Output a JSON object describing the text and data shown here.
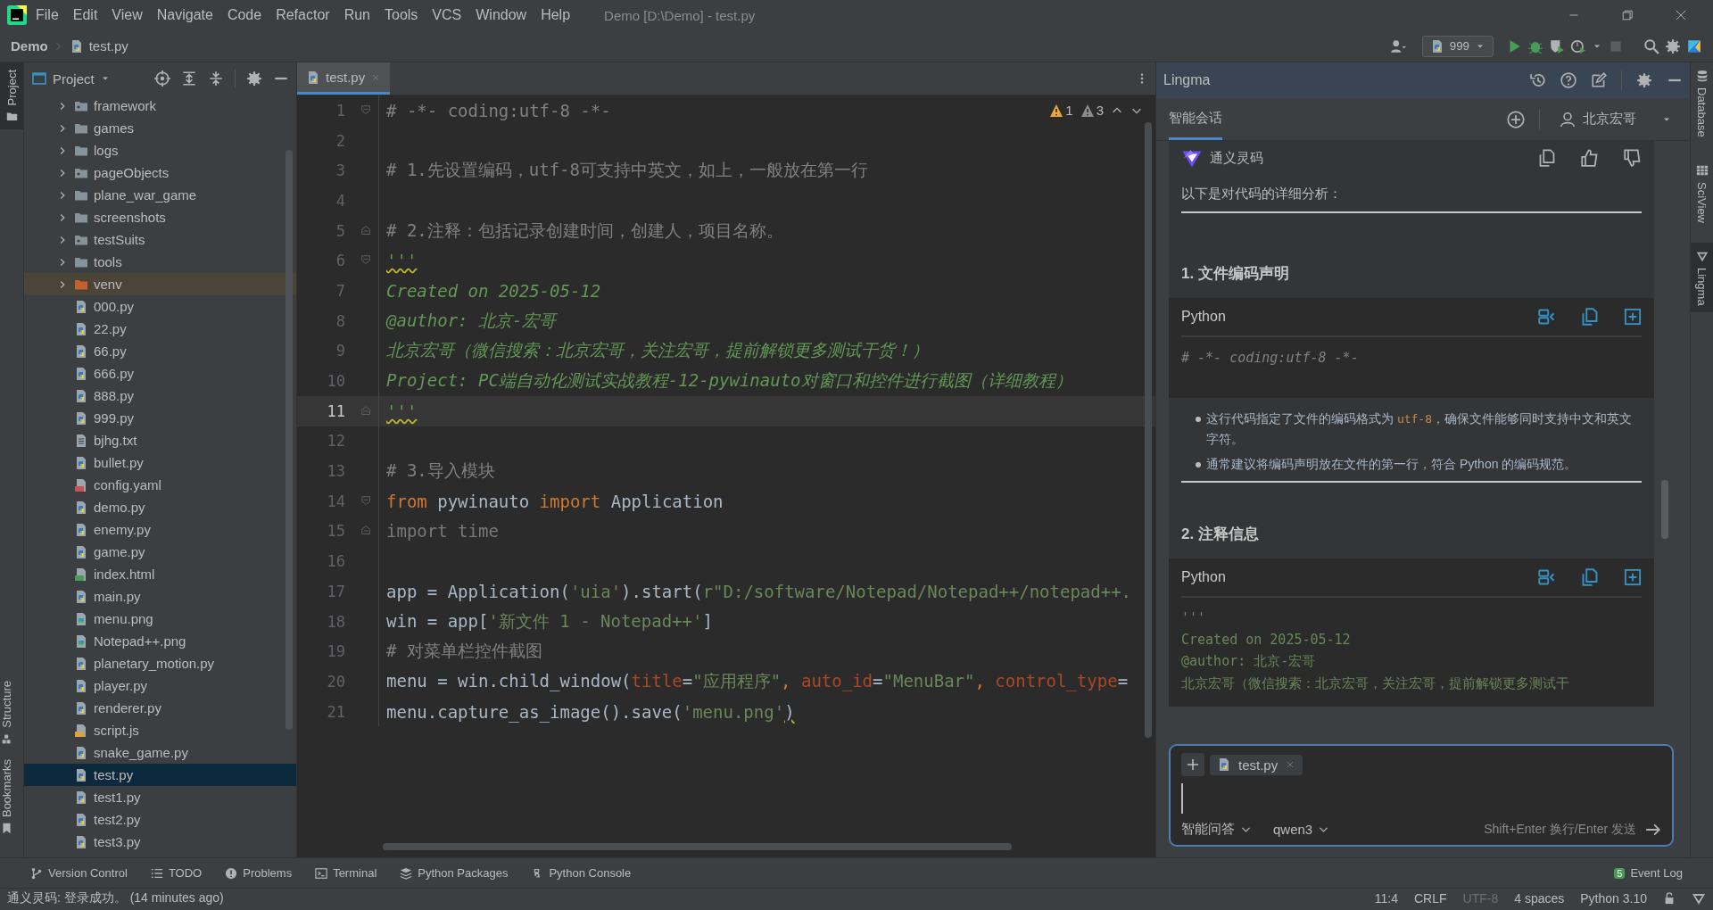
{
  "window": {
    "title": "Demo [D:\\Demo] - test.py"
  },
  "menu": [
    "File",
    "Edit",
    "View",
    "Navigate",
    "Code",
    "Refactor",
    "Run",
    "Tools",
    "VCS",
    "Window",
    "Help"
  ],
  "breadcrumbs": [
    "Demo",
    "test.py"
  ],
  "run_config": "999",
  "left_strip": [
    {
      "label": "Project",
      "selected": true,
      "kind": "top"
    },
    {
      "label": "Structure",
      "selected": false,
      "kind": "bottom"
    },
    {
      "label": "Bookmarks",
      "selected": false,
      "kind": "bottom"
    }
  ],
  "project": {
    "title": "Project",
    "items": [
      {
        "name": "framework",
        "kind": "package",
        "selected": false
      },
      {
        "name": "games",
        "kind": "folder",
        "selected": false
      },
      {
        "name": "logs",
        "kind": "folder",
        "selected": false
      },
      {
        "name": "pageObjects",
        "kind": "package",
        "selected": false
      },
      {
        "name": "plane_war_game",
        "kind": "folder",
        "selected": false
      },
      {
        "name": "screenshots",
        "kind": "folder",
        "selected": false
      },
      {
        "name": "testSuits",
        "kind": "package",
        "selected": false
      },
      {
        "name": "tools",
        "kind": "folder",
        "selected": false
      },
      {
        "name": "venv",
        "kind": "venv",
        "selected": false
      },
      {
        "name": "000.py",
        "kind": "python",
        "selected": false
      },
      {
        "name": "22.py",
        "kind": "python",
        "selected": false
      },
      {
        "name": "66.py",
        "kind": "python",
        "selected": false
      },
      {
        "name": "666.py",
        "kind": "python",
        "selected": false
      },
      {
        "name": "888.py",
        "kind": "python",
        "selected": false
      },
      {
        "name": "999.py",
        "kind": "python",
        "selected": false
      },
      {
        "name": "bjhg.txt",
        "kind": "text",
        "selected": false
      },
      {
        "name": "bullet.py",
        "kind": "python",
        "selected": false
      },
      {
        "name": "config.yaml",
        "kind": "yaml",
        "selected": false
      },
      {
        "name": "demo.py",
        "kind": "python",
        "selected": false
      },
      {
        "name": "enemy.py",
        "kind": "python",
        "selected": false
      },
      {
        "name": "game.py",
        "kind": "python",
        "selected": false
      },
      {
        "name": "index.html",
        "kind": "html",
        "selected": false
      },
      {
        "name": "main.py",
        "kind": "python",
        "selected": false
      },
      {
        "name": "menu.png",
        "kind": "image",
        "selected": false
      },
      {
        "name": "Notepad++.png",
        "kind": "image",
        "selected": false
      },
      {
        "name": "planetary_motion.py",
        "kind": "python",
        "selected": false
      },
      {
        "name": "player.py",
        "kind": "python",
        "selected": false
      },
      {
        "name": "renderer.py",
        "kind": "python",
        "selected": false
      },
      {
        "name": "script.js",
        "kind": "js",
        "selected": false
      },
      {
        "name": "snake_game.py",
        "kind": "python",
        "selected": false
      },
      {
        "name": "test.py",
        "kind": "python",
        "selected": true
      },
      {
        "name": "test1.py",
        "kind": "python",
        "selected": false
      },
      {
        "name": "test2.py",
        "kind": "python",
        "selected": false
      },
      {
        "name": "test3.py",
        "kind": "python",
        "selected": false
      }
    ]
  },
  "editor": {
    "tabs": [
      {
        "label": "test.py",
        "selected": true
      }
    ],
    "warnings": "1",
    "weak_warnings": "3",
    "lines": [
      {
        "number": "1",
        "current": false,
        "fold_start": true,
        "fold_end": false,
        "squiggle": false,
        "tokens": [
          {
            "text": "# -*- coding:utf-8 -*-",
            "kind": "comment"
          }
        ]
      },
      {
        "number": "2",
        "current": false,
        "fold_start": false,
        "fold_end": false
      },
      {
        "number": "3",
        "current": false,
        "fold_start": false,
        "fold_end": false,
        "squiggle": false,
        "tokens": [
          {
            "text": "# 1.先设置编码，utf-8可支持中英文，如上，一般放在第一行",
            "kind": "comment"
          }
        ]
      },
      {
        "number": "4",
        "current": false,
        "fold_start": false,
        "fold_end": false
      },
      {
        "number": "5",
        "current": false,
        "fold_start": false,
        "fold_end": true,
        "squiggle": false,
        "tokens": [
          {
            "text": "# 2.注释：包括记录创建时间，创建人，项目名称。",
            "kind": "comment"
          }
        ]
      },
      {
        "number": "6",
        "current": false,
        "fold_start": true,
        "fold_end": false,
        "squiggle": true,
        "tokens": [
          {
            "text": "'''",
            "kind": "doc"
          }
        ]
      },
      {
        "number": "7",
        "current": false,
        "fold_start": false,
        "fold_end": false,
        "squiggle": false,
        "tokens": [
          {
            "text": "Created on 2025-05-12",
            "kind": "doc"
          }
        ]
      },
      {
        "number": "8",
        "current": false,
        "fold_start": false,
        "fold_end": false,
        "squiggle": false,
        "tokens": [
          {
            "text": "@author: 北京-宏哥",
            "kind": "doc"
          }
        ]
      },
      {
        "number": "9",
        "current": false,
        "fold_start": false,
        "fold_end": false,
        "squiggle": false,
        "tokens": [
          {
            "text": "北京宏哥（微信搜索：北京宏哥，关注宏哥，提前解锁更多测试干货！）",
            "kind": "doc"
          }
        ]
      },
      {
        "number": "10",
        "current": false,
        "fold_start": false,
        "fold_end": false,
        "squiggle": false,
        "tokens": [
          {
            "text": "Project: PC端自动化测试实战教程-12-pywinauto对窗口和控件进行截图（详细教程）",
            "kind": "doc"
          }
        ]
      },
      {
        "number": "11",
        "current": true,
        "fold_start": false,
        "fold_end": true,
        "squiggle": true,
        "tokens": [
          {
            "text": "'''",
            "kind": "doc"
          }
        ]
      },
      {
        "number": "12",
        "current": false,
        "fold_start": false,
        "fold_end": false
      },
      {
        "number": "13",
        "current": false,
        "fold_start": false,
        "fold_end": false,
        "squiggle": false,
        "tokens": [
          {
            "text": "# 3.导入模块",
            "kind": "comment"
          }
        ]
      },
      {
        "number": "14",
        "current": false,
        "fold_start": true,
        "fold_end": false,
        "squiggle": false,
        "tokens": [
          {
            "text": "from",
            "kind": "keyword"
          },
          {
            "text": " pywinauto ",
            "kind": "plain"
          },
          {
            "text": "import",
            "kind": "keyword"
          },
          {
            "text": " Application",
            "kind": "plain"
          }
        ]
      },
      {
        "number": "15",
        "current": false,
        "fold_start": false,
        "fold_end": true,
        "squiggle": false,
        "tokens": [
          {
            "text": "import time",
            "kind": "unused"
          }
        ]
      },
      {
        "number": "16",
        "current": false,
        "fold_start": false,
        "fold_end": false
      },
      {
        "number": "17",
        "current": false,
        "fold_start": false,
        "fold_end": false,
        "squiggle": false,
        "tokens": [
          {
            "text": "app = Application(",
            "kind": "plain"
          },
          {
            "text": "'uia'",
            "kind": "string"
          },
          {
            "text": ").start(",
            "kind": "plain"
          },
          {
            "text": "r\"D:/software/Notepad/Notepad++/notepad++.",
            "kind": "string"
          }
        ]
      },
      {
        "number": "18",
        "current": false,
        "fold_start": false,
        "fold_end": false,
        "squiggle": false,
        "tokens": [
          {
            "text": "win = app[",
            "kind": "plain"
          },
          {
            "text": "'新文件 1 - Notepad++'",
            "kind": "string"
          },
          {
            "text": "]",
            "kind": "plain"
          }
        ]
      },
      {
        "number": "19",
        "current": false,
        "fold_start": false,
        "fold_end": false,
        "squiggle": false,
        "tokens": [
          {
            "text": "# 对菜单栏控件截图",
            "kind": "comment"
          }
        ]
      },
      {
        "number": "20",
        "current": false,
        "fold_start": false,
        "fold_end": false,
        "squiggle": false,
        "tokens": [
          {
            "text": "menu = win.child_window(",
            "kind": "plain"
          },
          {
            "text": "title",
            "kind": "param"
          },
          {
            "text": "=",
            "kind": "plain"
          },
          {
            "text": "\"应用程序\"",
            "kind": "string"
          },
          {
            "text": ", ",
            "kind": "keyword"
          },
          {
            "text": "auto_id",
            "kind": "param"
          },
          {
            "text": "=",
            "kind": "plain"
          },
          {
            "text": "\"MenuBar\"",
            "kind": "string"
          },
          {
            "text": ", ",
            "kind": "keyword"
          },
          {
            "text": "control_type",
            "kind": "param"
          },
          {
            "text": "=",
            "kind": "plain"
          }
        ]
      },
      {
        "number": "21",
        "current": false,
        "fold_start": false,
        "fold_end": false,
        "squiggle": true,
        "tokens": [
          {
            "text": "menu.capture_as_image().save(",
            "kind": "plain"
          },
          {
            "text": "'menu.png'",
            "kind": "string"
          },
          {
            "text": ")",
            "kind": "plain"
          }
        ]
      }
    ]
  },
  "assistant": {
    "title": "Lingma",
    "tabs": [
      {
        "label": "智能会话",
        "selected": true
      }
    ],
    "user": "北京宏哥",
    "message": {
      "author": "通义灵码",
      "intro": "以下是对代码的详细分析：",
      "sections": [
        {
          "heading": "1. 文件编码声明",
          "code": {
            "language": "Python",
            "lines": [
              {
                "text": "# -*- coding:utf-8 -*-",
                "kind": "comment"
              }
            ]
          },
          "bullets": [
            [
              {
                "text": "这行代码指定了文件的编码格式为 ",
                "kind": "plain"
              },
              {
                "text": "utf-8",
                "kind": "code"
              },
              {
                "text": "，确保文件能够同时支持中文和英文字符。",
                "kind": "plain"
              }
            ],
            [
              {
                "text": "通常建议将编码声明放在文件的第一行，符合 Python 的编码规范。",
                "kind": "plain"
              }
            ]
          ]
        },
        {
          "heading": "2. 注释信息",
          "code": {
            "language": "Python",
            "lines": [
              {
                "text": "'''",
                "kind": "string"
              },
              {
                "text": "Created on 2025-05-12",
                "kind": "string"
              },
              {
                "text": "@author: 北京-宏哥",
                "kind": "string"
              },
              {
                "text": "北京宏哥（微信搜索：北京宏哥，关注宏哥，提前解锁更多测试干",
                "kind": "string"
              }
            ]
          }
        }
      ]
    },
    "input": {
      "attachments": [
        "test.py"
      ],
      "mode": "智能问答",
      "model": "qwen3",
      "hint": "Shift+Enter 换行/Enter 发送"
    }
  },
  "right_strip": [
    {
      "label": "Database",
      "selected": false
    },
    {
      "label": "SciView",
      "selected": false
    },
    {
      "label": "Lingma",
      "selected": true
    }
  ],
  "tool_windows": [
    "Version Control",
    "TODO",
    "Problems",
    "Terminal",
    "Python Packages",
    "Python Console"
  ],
  "event_log": {
    "label": "Event Log",
    "count": "5"
  },
  "status_bar": {
    "message": "通义灵码: 登录成功。 (14 minutes ago)",
    "items": [
      {
        "text": "11:4",
        "disabled": false
      },
      {
        "text": "CRLF",
        "disabled": false
      },
      {
        "text": "UTF-8",
        "disabled": true
      },
      {
        "text": "4 spaces",
        "disabled": false
      },
      {
        "text": "Python 3.10",
        "disabled": false
      }
    ]
  }
}
